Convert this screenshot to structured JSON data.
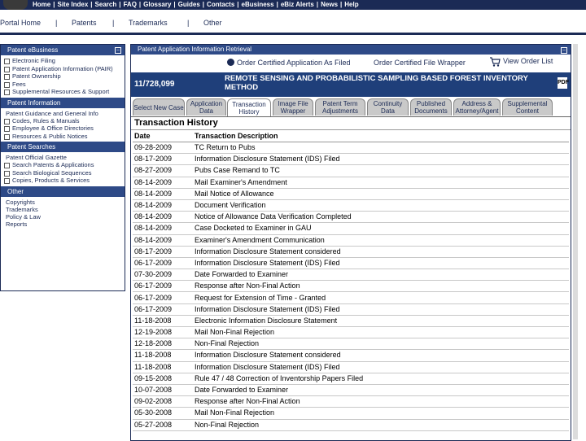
{
  "topnav": {
    "items": [
      "Home",
      "Site Index",
      "Search",
      "FAQ",
      "Glossary",
      "Guides",
      "Contacts",
      "eBusiness",
      "eBiz Alerts",
      "News",
      "Help"
    ]
  },
  "secnav": {
    "items": [
      "Portal Home",
      "Patents",
      "Trademarks",
      "Other"
    ],
    "separator": "|"
  },
  "sidebar": {
    "ebusiness": {
      "title": "Patent eBusiness",
      "items": [
        "Electronic Filing",
        "Patent Application Information (PAIR)",
        "Patent Ownership",
        "Fees",
        "Supplemental Resources & Support"
      ]
    },
    "info": {
      "title": "Patent Information",
      "items": [
        "Patent Guidance and General Info",
        "Codes, Rules & Manuals",
        "Employee & Office Directories",
        "Resources & Public Notices"
      ]
    },
    "searches": {
      "title": "Patent Searches",
      "items": [
        "Patent Official Gazette",
        "Search Patents & Applications",
        "Search Biological Sequences",
        "Copies, Products & Services"
      ]
    },
    "other": {
      "title": "Other",
      "items": [
        "Copyrights",
        "Trademarks",
        "Policy & Law",
        "Reports"
      ]
    }
  },
  "main": {
    "title": "Patent Application Information Retrieval",
    "order_certified": "Order Certified Application As Filed",
    "order_wrapper": "Order Certified File Wrapper",
    "view_order_list": "View Order List",
    "app_number": "11/728,099",
    "app_title": "REMOTE SENSING AND PROBABILISTIC SAMPLING BASED FOREST INVENTORY METHOD",
    "tabs": [
      {
        "label": "Select New Case"
      },
      {
        "label": "Application Data"
      },
      {
        "label": "Transaction History"
      },
      {
        "label": "Image File Wrapper"
      },
      {
        "label": "Patent Term Adjustments"
      },
      {
        "label": "Continuity Data"
      },
      {
        "label": "Published Documents"
      },
      {
        "label": "Address & Attorney/Agent"
      },
      {
        "label": "Supplemental Content"
      }
    ],
    "active_tab": "Transaction History",
    "section_title": "Transaction History",
    "columns": [
      "Date",
      "Transaction Description"
    ],
    "rows": [
      [
        "09-28-2009",
        "TC Return to Pubs"
      ],
      [
        "08-17-2009",
        "Information Disclosure Statement (IDS) Filed"
      ],
      [
        "08-27-2009",
        "Pubs Case Remand to TC"
      ],
      [
        "08-14-2009",
        "Mail Examiner's Amendment"
      ],
      [
        "08-14-2009",
        "Mail Notice of Allowance"
      ],
      [
        "08-14-2009",
        "Document Verification"
      ],
      [
        "08-14-2009",
        "Notice of Allowance Data Verification Completed"
      ],
      [
        "08-14-2009",
        "Case Docketed to Examiner in GAU"
      ],
      [
        "08-14-2009",
        "Examiner's Amendment Communication"
      ],
      [
        "08-17-2009",
        "Information Disclosure Statement considered"
      ],
      [
        "06-17-2009",
        "Information Disclosure Statement (IDS) Filed"
      ],
      [
        "07-30-2009",
        "Date Forwarded to Examiner"
      ],
      [
        "06-17-2009",
        "Response after Non-Final Action"
      ],
      [
        "06-17-2009",
        "Request for Extension of Time - Granted"
      ],
      [
        "06-17-2009",
        "Information Disclosure Statement (IDS) Filed"
      ],
      [
        "11-18-2008",
        "Electronic Information Disclosure Statement"
      ],
      [
        "12-19-2008",
        "Mail Non-Final Rejection"
      ],
      [
        "12-18-2008",
        "Non-Final Rejection"
      ],
      [
        "11-18-2008",
        "Information Disclosure Statement considered"
      ],
      [
        "11-18-2008",
        "Information Disclosure Statement (IDS) Filed"
      ],
      [
        "09-15-2008",
        "Rule 47 / 48 Correction of Inventorship Papers Filed"
      ],
      [
        "10-07-2008",
        "Date Forwarded to Examiner"
      ],
      [
        "09-02-2008",
        "Response after Non-Final Action"
      ],
      [
        "05-30-2008",
        "Mail Non-Final Rejection"
      ],
      [
        "05-27-2008",
        "Non-Final Rejection"
      ]
    ]
  },
  "colors": {
    "navy": "#1b2a55",
    "header_blue": "#2e4a87",
    "appbar_blue": "#1f3f7a",
    "tab_gray": "#c9c9c9"
  }
}
